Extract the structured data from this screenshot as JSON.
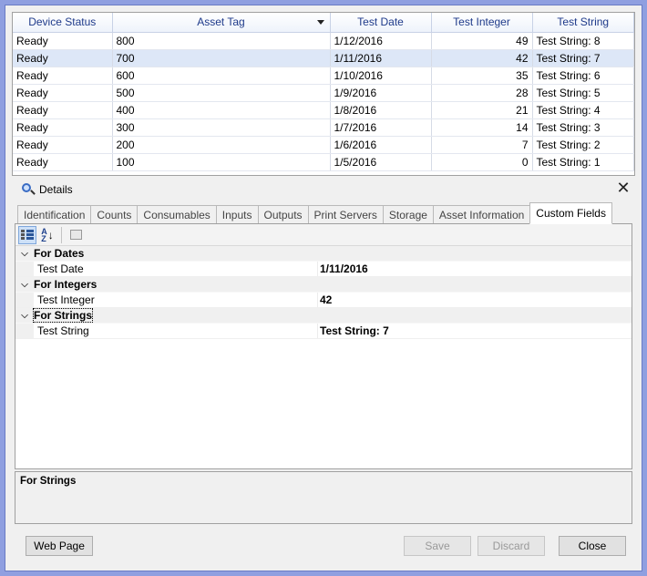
{
  "grid": {
    "columns": [
      "Device Status",
      "Asset Tag",
      "Test Date",
      "Test Integer",
      "Test String"
    ],
    "rows": [
      {
        "status": "Ready",
        "tag": "800",
        "date": "1/12/2016",
        "int": "49",
        "str": "Test String: 8"
      },
      {
        "status": "Ready",
        "tag": "700",
        "date": "1/11/2016",
        "int": "42",
        "str": "Test String: 7"
      },
      {
        "status": "Ready",
        "tag": "600",
        "date": "1/10/2016",
        "int": "35",
        "str": "Test String: 6"
      },
      {
        "status": "Ready",
        "tag": "500",
        "date": "1/9/2016",
        "int": "28",
        "str": "Test String: 5"
      },
      {
        "status": "Ready",
        "tag": "400",
        "date": "1/8/2016",
        "int": "21",
        "str": "Test String: 4"
      },
      {
        "status": "Ready",
        "tag": "300",
        "date": "1/7/2016",
        "int": "14",
        "str": "Test String: 3"
      },
      {
        "status": "Ready",
        "tag": "200",
        "date": "1/6/2016",
        "int": "7",
        "str": "Test String: 2"
      },
      {
        "status": "Ready",
        "tag": "100",
        "date": "1/5/2016",
        "int": "0",
        "str": "Test String: 1"
      }
    ]
  },
  "details": {
    "title": "Details",
    "close": "✕",
    "tabs": [
      "Identification",
      "Counts",
      "Consumables",
      "Inputs",
      "Outputs",
      "Print Servers",
      "Storage",
      "Asset Information",
      "Custom Fields"
    ],
    "categories": [
      {
        "label": "For Dates",
        "prop": "Test Date",
        "value": "1/11/2016"
      },
      {
        "label": "For Integers",
        "prop": "Test Integer",
        "value": "42"
      },
      {
        "label": "For Strings",
        "prop": "Test String",
        "value": "Test String: 7"
      }
    ],
    "description": "For Strings"
  },
  "buttons": {
    "web_page": "Web Page",
    "save": "Save",
    "discard": "Discard",
    "close": "Close"
  },
  "icons": {
    "sort": "sort-caret",
    "details": "magnifier-icon",
    "categorized": "categorized-icon",
    "alphabetical": "alphabetical-icon",
    "property_pages": "property-pages-icon"
  }
}
